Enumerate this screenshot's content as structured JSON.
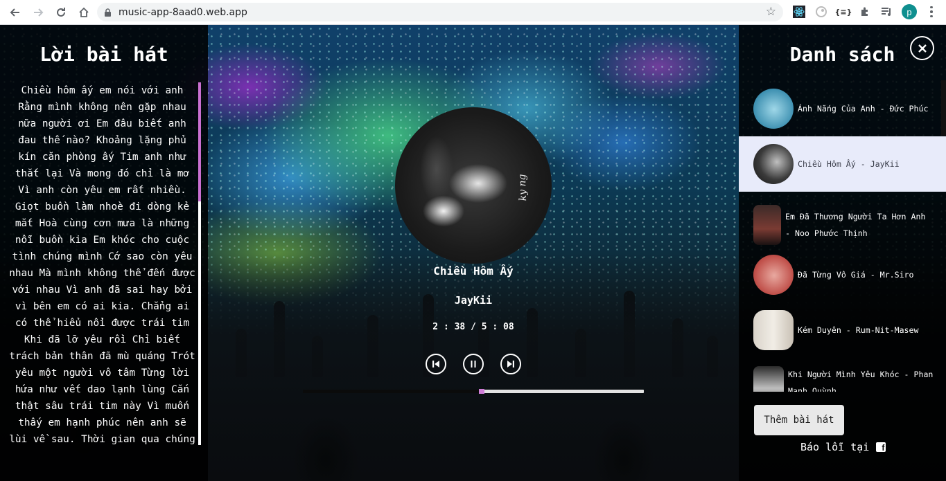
{
  "browser": {
    "url": "music-app-8aad0.web.app",
    "profile_initial": "p",
    "ext_json_label": "{≡}"
  },
  "lyrics": {
    "title": "Lời bài hát",
    "text": "Chiều hôm ấy em nói với anh Rằng mình không nên gặp nhau nữa người ơi Em đâu biết anh đau thế nào? Khoảng lặng phủ kín căn phòng ấy Tim anh như thắt lại Và mong đó chỉ là mơ Vì anh còn yêu em rất nhiều. Giọt buồn làm nhoè đi dòng kẻ mắt Hoà cùng cơn mưa là những nỗi buồn kia Em khóc cho cuộc tình chúng mình Cớ sao còn yêu nhau Mà mình không thể đến được với nhau Vì anh đã sai hay bởi vì bên em có ai kia. Chẳng ai có thể hiểu nổi được trái tim Khi đã lỡ yêu rồi Chỉ biết trách bản thân đã mù quáng Trót yêu một người vô tâm Từng lời hứa như vết dao lạnh lùng Cắn thật sâu trái tim này Vì muốn thấy em hạnh phúc nên anh sẽ lùi về sau. Thời gian qua chúng"
  },
  "player": {
    "title": "Chiều Hôm Ấy",
    "artist": "JayKii",
    "time": "2 : 38 / 5 : 08",
    "progress": 0.52,
    "album_script": "ky ng"
  },
  "playlist": {
    "title": "Danh sách",
    "songs": [
      {
        "label": "Ánh Nắng Của Anh - Đức Phúc",
        "active": false
      },
      {
        "label": "Chiều Hôm Ấy - JayKii",
        "active": true
      },
      {
        "label": "Em Đã Thương Người Ta Hơn Anh - Noo Phước Thịnh",
        "active": false
      },
      {
        "label": "Đã Từng Vô Giá - Mr.Siro",
        "active": false
      },
      {
        "label": "Kém Duyên - Rum-Nit-Masew",
        "active": false
      },
      {
        "label": "Khi Người Mình Yêu Khóc - Phan Mạnh Quỳnh",
        "active": false
      }
    ],
    "add_button": "Thêm bài hát",
    "report_label": "Báo lỗi tại",
    "report_icon": "facebook-icon",
    "report_icon_glyph": "f"
  },
  "colors": {
    "accent": "#c96fd0",
    "active_row": "#e8ebfa"
  }
}
